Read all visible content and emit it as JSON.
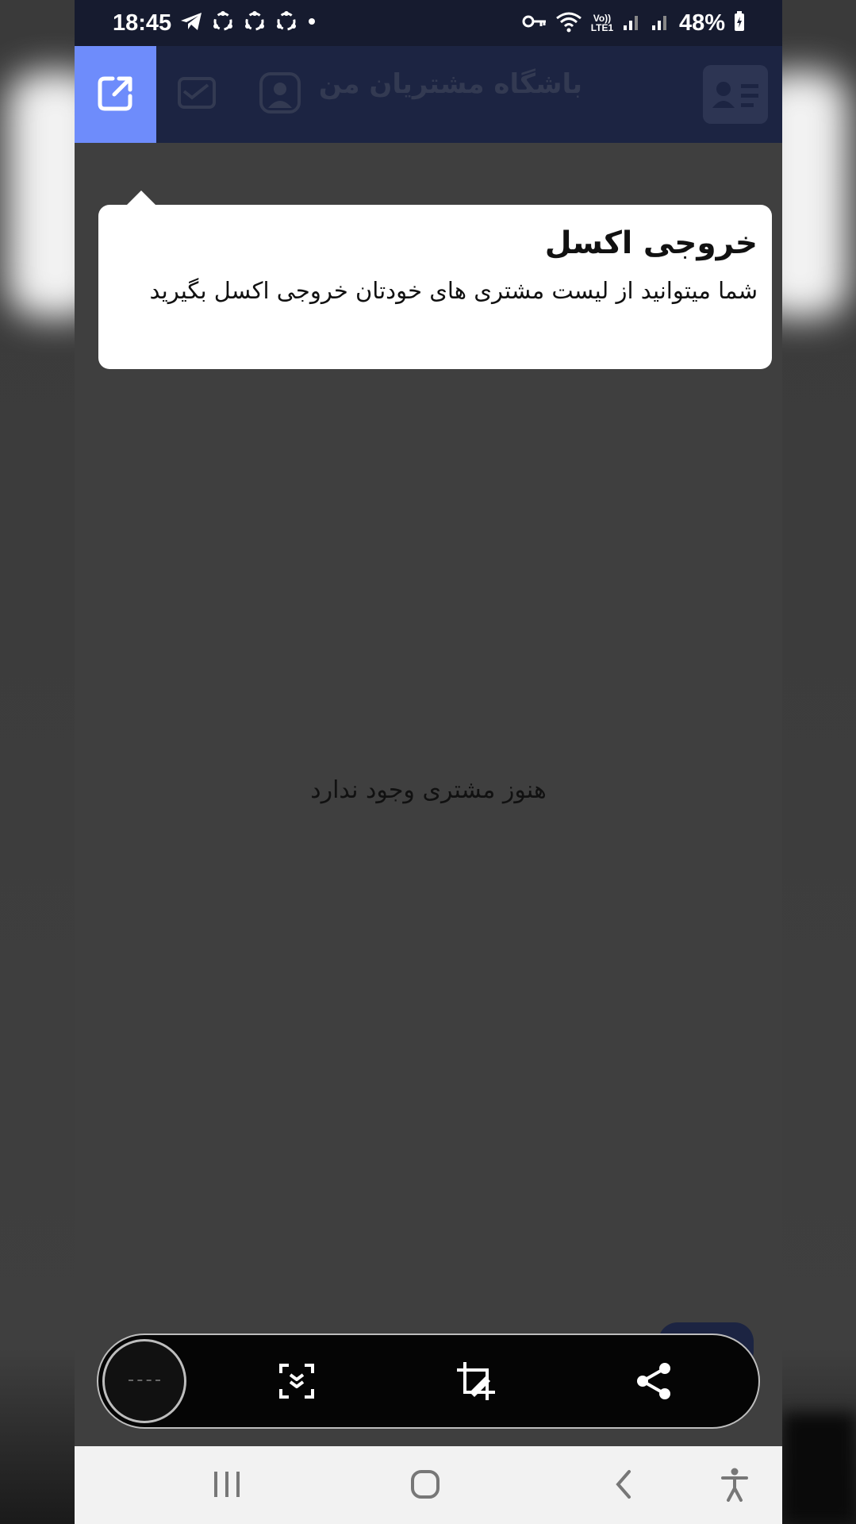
{
  "status_bar": {
    "time": "18:45",
    "battery": "48%",
    "network_label": "Vo)) LTE1",
    "icons": [
      "telegram-icon",
      "app-notification-icon",
      "app-notification-icon",
      "app-notification-icon",
      "dot-icon",
      "vpn-key-icon",
      "wifi-icon",
      "signal-icon",
      "signal-icon",
      "battery-charging-icon"
    ]
  },
  "app_bar": {
    "title": "باشگاه مشتریان من",
    "icons": [
      "export-icon",
      "message-icon",
      "profile-icon",
      "contact-card-icon"
    ],
    "accent": "#6e8cfb",
    "background": "#1c2442"
  },
  "tooltip": {
    "title": "خروجی اکسل",
    "body": "شما میتوانید  از لیست مشتری های خودتان خروجی اکسل بگیرید"
  },
  "main": {
    "empty_message": "هنوز مشتری وجود ندارد"
  },
  "screenshot_toolbar": {
    "icons": [
      "preview-thumbnail",
      "scroll-capture-icon",
      "crop-edit-icon",
      "share-icon"
    ]
  },
  "nav_bar": {
    "icons": [
      "recent-apps-icon",
      "home-icon",
      "back-icon",
      "accessibility-icon"
    ]
  }
}
